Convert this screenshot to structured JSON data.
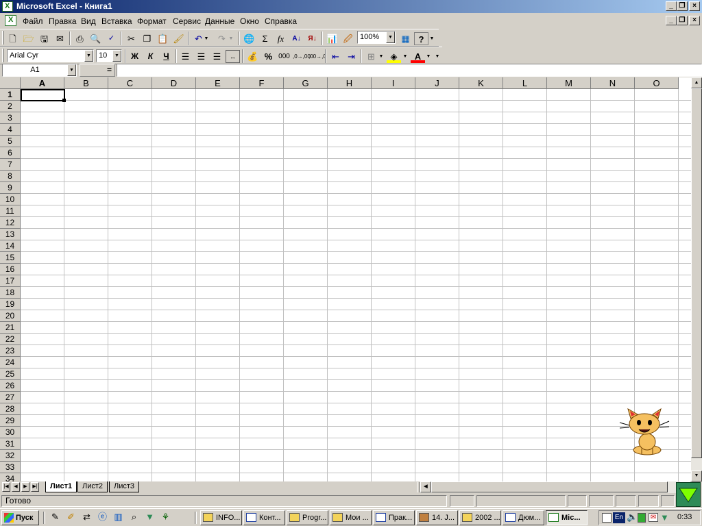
{
  "window": {
    "title": "Microsoft Excel - Книга1"
  },
  "menu": [
    "Файл",
    "Правка",
    "Вид",
    "Вставка",
    "Формат",
    "Сервис",
    "Данные",
    "Окно",
    "Справка"
  ],
  "toolbar": {
    "zoom": "100%",
    "font_name": "Arial Cyr",
    "font_size": "10",
    "bold_label": "Ж",
    "italic_label": "К",
    "underline_label": "Ч",
    "percent_label": "%",
    "thousands_label": "000",
    "inc_decimal_label": ",0→,00",
    "dec_decimal_label": ",00→,0",
    "sum_label": "Σ",
    "fx_label": "fx",
    "help_label": "?"
  },
  "formula_bar": {
    "name_box": "A1",
    "equals": "=",
    "content": ""
  },
  "grid": {
    "columns": [
      "A",
      "B",
      "C",
      "D",
      "E",
      "F",
      "G",
      "H",
      "I",
      "J",
      "K",
      "L",
      "M",
      "N",
      "O"
    ],
    "rows": [
      "1",
      "2",
      "3",
      "4",
      "5",
      "6",
      "7",
      "8",
      "9",
      "10",
      "11",
      "12",
      "13",
      "14",
      "15",
      "16",
      "17",
      "18",
      "19",
      "20",
      "21",
      "22",
      "23",
      "24",
      "25",
      "26",
      "27",
      "28",
      "29",
      "30",
      "31",
      "32",
      "33",
      "34"
    ],
    "active_cell": "A1"
  },
  "sheets": [
    {
      "label": "Лист1",
      "active": true
    },
    {
      "label": "Лист2",
      "active": false
    },
    {
      "label": "Лист3",
      "active": false
    }
  ],
  "status": {
    "text": "Готово"
  },
  "taskbar": {
    "start_label": "Пуск",
    "tasks": [
      {
        "label": "INFO...",
        "icon": "folder-icon",
        "active": false
      },
      {
        "label": "Конт...",
        "icon": "word-icon",
        "active": false
      },
      {
        "label": "Progr...",
        "icon": "folder-icon",
        "active": false
      },
      {
        "label": "Мои ...",
        "icon": "folder-icon",
        "active": false
      },
      {
        "label": "Прак...",
        "icon": "word-icon",
        "active": false
      },
      {
        "label": "14. J...",
        "icon": "tool-icon",
        "active": false
      },
      {
        "label": "2002 ...",
        "icon": "folder-icon",
        "active": false
      },
      {
        "label": "Дюм...",
        "icon": "word-icon",
        "active": false
      },
      {
        "label": "Mic...",
        "icon": "excel-icon",
        "active": true
      }
    ],
    "lang": "En",
    "clock": "0:33"
  }
}
